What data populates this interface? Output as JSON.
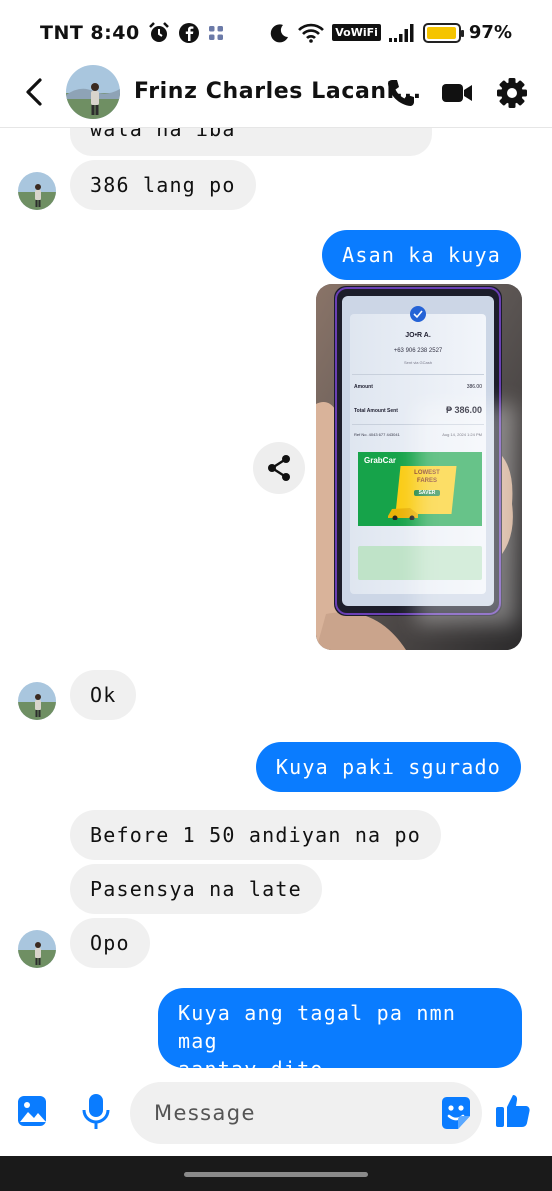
{
  "status_bar": {
    "carrier_time": "TNT 8:40",
    "vowifi": "VoWiFi",
    "battery_level": 0.97,
    "battery_text": "97%"
  },
  "header": {
    "contact_name": "Frinz Charles Lacani...",
    "icons": [
      "back-icon",
      "phone-icon",
      "video-call-icon",
      "gear-icon"
    ]
  },
  "messages": [
    {
      "side": "in",
      "text": "wala na iba"
    },
    {
      "side": "in",
      "text": "386 lang po"
    },
    {
      "side": "out",
      "text": "Asan ka kuya"
    },
    {
      "side": "out",
      "type": "photo"
    },
    {
      "side": "in",
      "text": "Ok"
    },
    {
      "side": "out",
      "text": "Kuya paki sgurado"
    },
    {
      "side": "in",
      "text": "Before 1 50 andiyan na po"
    },
    {
      "side": "in",
      "text": "Pasensya na late"
    },
    {
      "side": "in",
      "text": "Opo"
    },
    {
      "side": "out",
      "text_line1": "Kuya ang tagal pa nmn mag",
      "text_line2": "aantay dito"
    }
  ],
  "photo_receipt": {
    "name": "JO•R A.",
    "phone": "+63 906 238 2527",
    "sent_via": "Sent via GCash",
    "amount_label": "Amount",
    "amount_value": "386.00",
    "total_label": "Total Amount Sent",
    "total_value": "₱ 386.00",
    "ref": "Ref No. 4043 677 443041",
    "date": "Aug 14, 2024 1:24 PM",
    "ad_brand": "GrabCar",
    "ad_line1": "LOWEST",
    "ad_line2": "FARES",
    "ad_badge": "SAVER"
  },
  "composer": {
    "placeholder": "Message",
    "icons": [
      "gallery-icon",
      "microphone-icon",
      "sticker-icon",
      "thumbs-up-icon"
    ]
  },
  "colors": {
    "accent": "#0a7cff",
    "incoming_bubble": "#f0f0f0"
  }
}
